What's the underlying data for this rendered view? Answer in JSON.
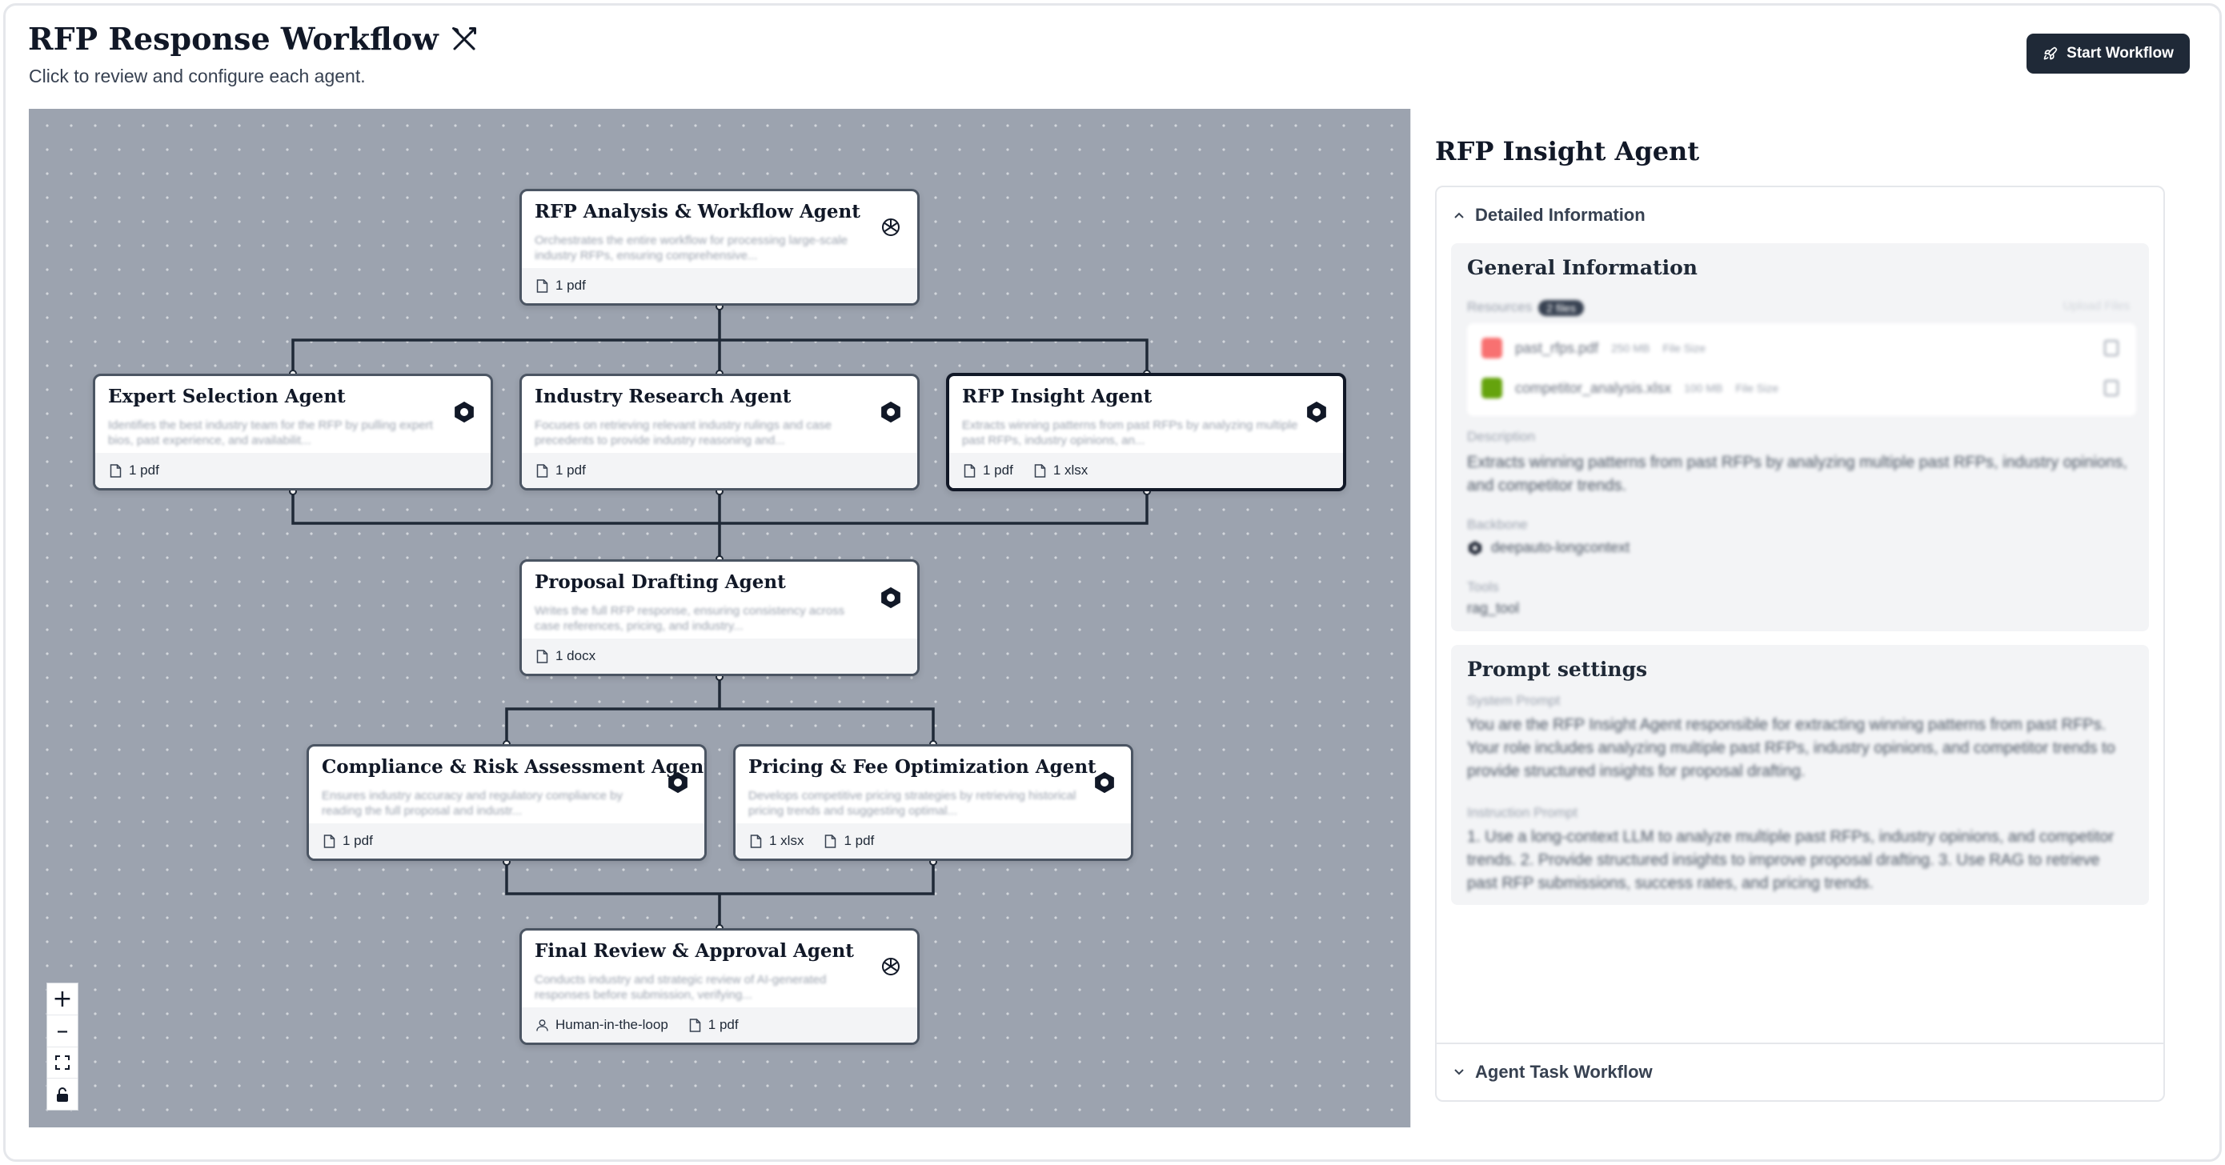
{
  "header": {
    "title": "RFP Response Workflow",
    "subtitle": "Click to review and configure each agent.",
    "start_label": "Start Workflow"
  },
  "nodes": [
    {
      "title": "RFP Analysis & Workflow Agent",
      "desc": "Orchestrates the entire workflow for processing large-scale industry RFPs, ensuring comprehensive...",
      "icon": "openai-icon",
      "resources": [
        "1 pdf"
      ]
    },
    {
      "title": "Expert Selection Agent",
      "desc": "Identifies the best industry team for the RFP by pulling expert bios, past experience, and availabilit...",
      "icon": "hexagon-icon",
      "resources": [
        "1 pdf"
      ]
    },
    {
      "title": "Industry Research Agent",
      "desc": "Focuses on retrieving relevant industry rulings and case precedents to provide industry reasoning and...",
      "icon": "hexagon-icon",
      "resources": [
        "1 pdf"
      ]
    },
    {
      "title": "RFP Insight Agent",
      "desc": "Extracts winning patterns from past RFPs by analyzing multiple past RFPs, industry opinions, an...",
      "icon": "hexagon-icon",
      "resources": [
        "1 pdf",
        "1 xlsx"
      ]
    },
    {
      "title": "Proposal Drafting Agent",
      "desc": "Writes the full RFP response, ensuring consistency across case references, pricing, and industry...",
      "icon": "hexagon-icon",
      "resources": [
        "1 docx"
      ]
    },
    {
      "title": "Compliance & Risk Assessment Agent",
      "desc": "Ensures industry accuracy and regulatory compliance by reading the full proposal and industr...",
      "icon": "hexagon-icon",
      "resources": [
        "1 pdf"
      ]
    },
    {
      "title": "Pricing & Fee Optimization Agent",
      "desc": "Develops competitive pricing strategies by retrieving historical pricing trends and suggesting optimal...",
      "icon": "hexagon-icon",
      "resources": [
        "1 xlsx",
        "1 pdf"
      ]
    },
    {
      "title": "Final Review & Approval Agent",
      "desc": "Conducts industry and strategic review of AI-generated responses before submission, verifying...",
      "icon": "openai-icon",
      "resources": [
        "Human-in-the-loop",
        "1 pdf"
      ]
    }
  ],
  "zoom": {
    "plus": "+",
    "minus": "–"
  },
  "panel": {
    "title": "RFP Insight Agent",
    "detailed_label": "Detailed Information",
    "general_title": "General Information",
    "resources_label": "Resources",
    "files_badge": "2 files",
    "upload_label": "Upload Files",
    "files": [
      {
        "name": "past_rfps.pdf",
        "size": "250 MB",
        "meta": "File Size",
        "color": "#f87171"
      },
      {
        "name": "competitor_analysis.xlsx",
        "size": "100 MB",
        "meta": "File Size",
        "color": "#65a30d"
      }
    ],
    "description_label": "Description",
    "description": "Extracts winning patterns from past RFPs by analyzing multiple past RFPs, industry opinions, and competitor trends.",
    "backbone_label": "Backbone",
    "backbone": "deepauto-longcontext",
    "tools_label": "Tools",
    "tools": "rag_tool",
    "prompt_title": "Prompt settings",
    "system_label": "System Prompt",
    "system_prompt": "You are the RFP Insight Agent responsible for extracting winning patterns from past RFPs. Your role includes analyzing multiple past RFPs, industry opinions, and competitor trends to provide structured insights for proposal drafting.",
    "instruction_label": "Instruction Prompt",
    "instruction_prompt": "1. Use a long-context LLM to analyze multiple past RFPs, industry opinions, and competitor trends. 2. Provide structured insights to improve proposal drafting. 3. Use RAG to retrieve past RFP submissions, success rates, and pricing trends.",
    "workflow_label": "Agent Task Workflow"
  },
  "colors": {
    "canvas": "#9ca3af",
    "primary": "#1f2937",
    "edge": "#1f2937"
  }
}
